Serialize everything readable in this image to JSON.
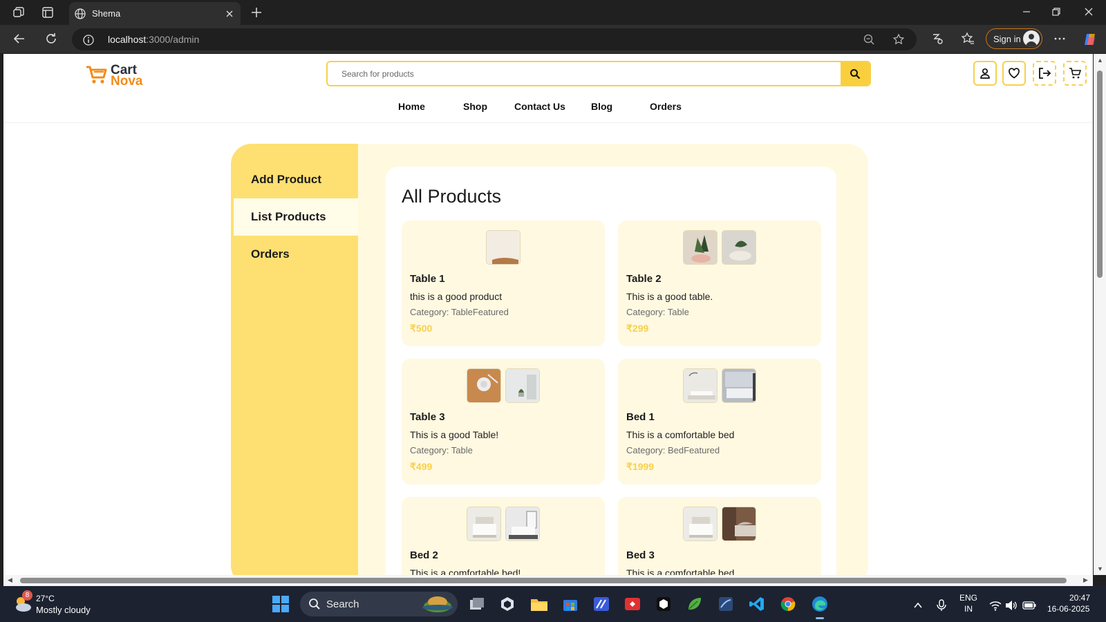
{
  "browser": {
    "tab_title": "Shema",
    "url_host": "localhost",
    "url_path": ":3000/admin",
    "signin_label": "Sign in"
  },
  "site": {
    "logo_word1": "Cart",
    "logo_word2": "Nova",
    "search_placeholder": "Search for products",
    "nav": [
      "Home",
      "Shop",
      "Contact Us",
      "Blog",
      "Orders"
    ]
  },
  "admin": {
    "sidebar": [
      {
        "label": "Add Product",
        "active": false
      },
      {
        "label": "List Products",
        "active": true
      },
      {
        "label": "Orders",
        "active": false
      }
    ],
    "title": "All Products",
    "products": [
      {
        "name": "Table 1",
        "description": "this is a good product",
        "category": "Category: TableFeatured",
        "price": "₹500",
        "thumbs": 1
      },
      {
        "name": "Table 2",
        "description": "This is a good table.",
        "category": "Category: Table",
        "price": "₹299",
        "thumbs": 2
      },
      {
        "name": "Table 3",
        "description": "This is a good Table!",
        "category": "Category: Table",
        "price": "₹499",
        "thumbs": 2
      },
      {
        "name": "Bed 1",
        "description": "This is a comfortable bed",
        "category": "Category: BedFeatured",
        "price": "₹1999",
        "thumbs": 2
      },
      {
        "name": "Bed 2",
        "description": "This is a comfortable bed!",
        "category": "",
        "price": "",
        "thumbs": 2
      },
      {
        "name": "Bed 3",
        "description": "This is a comfortable bed",
        "category": "",
        "price": "",
        "thumbs": 2
      }
    ],
    "colors": {
      "accent": "#f7d04d",
      "sidebar": "#fedf72",
      "panel": "#fff9df",
      "card": "#fff9e1"
    }
  },
  "taskbar": {
    "weather_badge": "8",
    "weather_temp": "27°C",
    "weather_desc": "Mostly cloudy",
    "search_label": "Search",
    "lang_line1": "ENG",
    "lang_line2": "IN",
    "time": "20:47",
    "date": "16-06-2025"
  }
}
